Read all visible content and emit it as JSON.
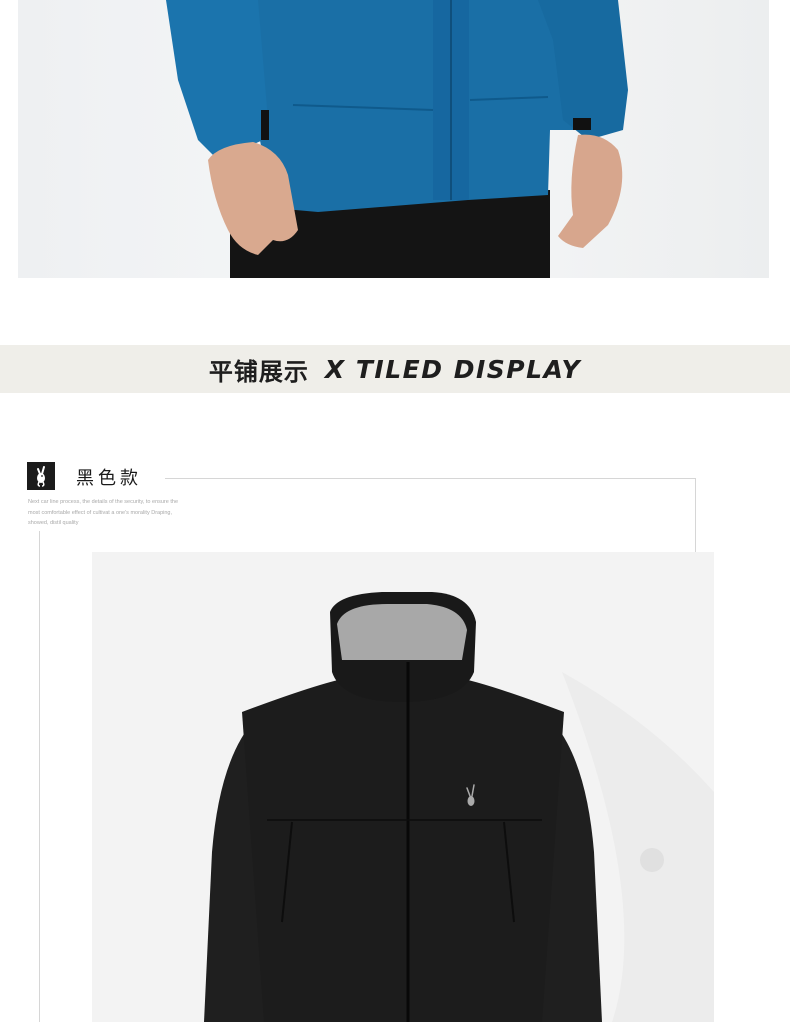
{
  "banner": {
    "title_cn": "平铺展示",
    "title_en": "X TILED DISPLAY"
  },
  "section": {
    "variant_label": "黑色款",
    "description": "Next car line process, the details of the security, to ensure the most comfortable effect of cultivat a one's morality Draping, showed, distil quality"
  },
  "images": {
    "hero": "model-wearing-blue-jacket-photo",
    "product": "black-hooded-jacket-photo"
  },
  "colors": {
    "jacket_blue": "#1a6fa6",
    "jacket_black": "#1c1c1c",
    "banner_bg": "#efeee9"
  }
}
